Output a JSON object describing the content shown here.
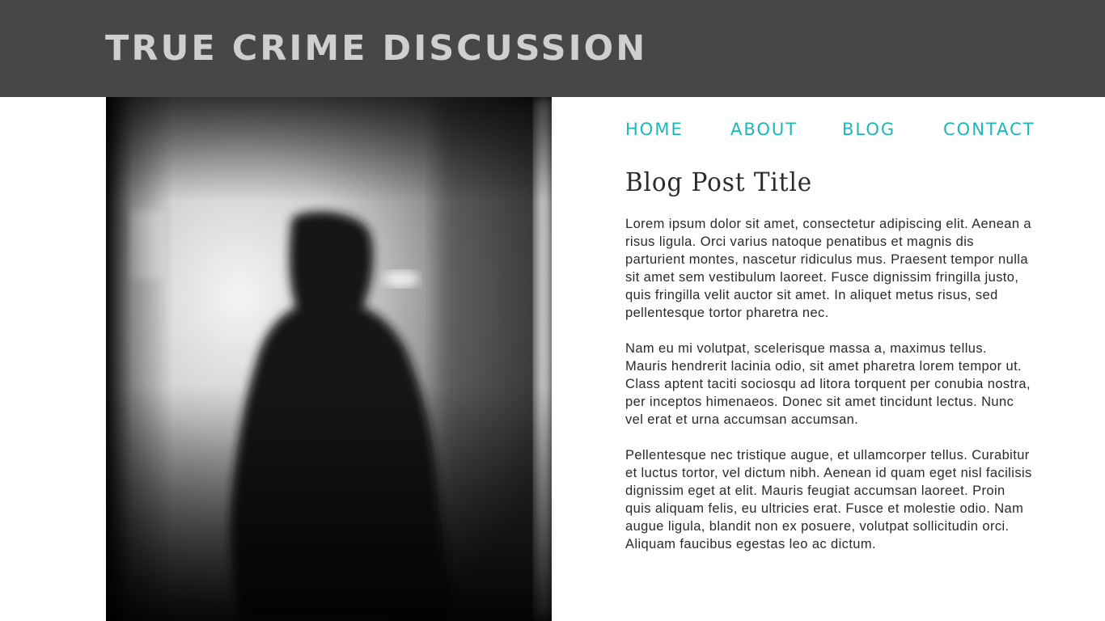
{
  "header": {
    "site_title": "TRUE CRIME DISCUSSION",
    "background_color": "#474747",
    "title_color": "#cfcfcf"
  },
  "hero": {
    "image_description_icon": "silhouette-photo"
  },
  "nav": {
    "accent_color": "#1ab6bd",
    "items": [
      {
        "label": "HOME"
      },
      {
        "label": "ABOUT"
      },
      {
        "label": "BLOG"
      },
      {
        "label": "CONTACT"
      }
    ]
  },
  "post": {
    "title": "Blog Post Title",
    "paragraphs": [
      "Lorem ipsum dolor sit amet, consectetur adipiscing elit. Aenean a risus ligula. Orci varius natoque penatibus et magnis dis parturient montes, nascetur ridiculus mus. Praesent tempor nulla sit amet sem vestibulum laoreet. Fusce dignissim fringilla justo, quis fringilla velit auctor sit amet. In aliquet metus risus, sed pellentesque tortor pharetra nec.",
      "Nam eu mi volutpat, scelerisque massa a, maximus tellus. Mauris hendrerit lacinia odio, sit amet pharetra lorem tempor ut. Class aptent taciti sociosqu ad litora torquent per conubia nostra, per inceptos himenaeos. Donec sit amet tincidunt lectus. Nunc vel erat et urna accumsan accumsan.",
      "Pellentesque nec tristique augue, et ullamcorper tellus. Curabitur et luctus tortor, vel dictum nibh. Aenean id quam eget nisl facilisis dignissim eget at elit. Mauris feugiat accumsan laoreet. Proin quis aliquam felis, eu ultricies erat. Fusce et molestie odio. Nam augue ligula, blandit non ex posuere, volutpat sollicitudin orci. Aliquam faucibus egestas leo ac dictum."
    ]
  }
}
